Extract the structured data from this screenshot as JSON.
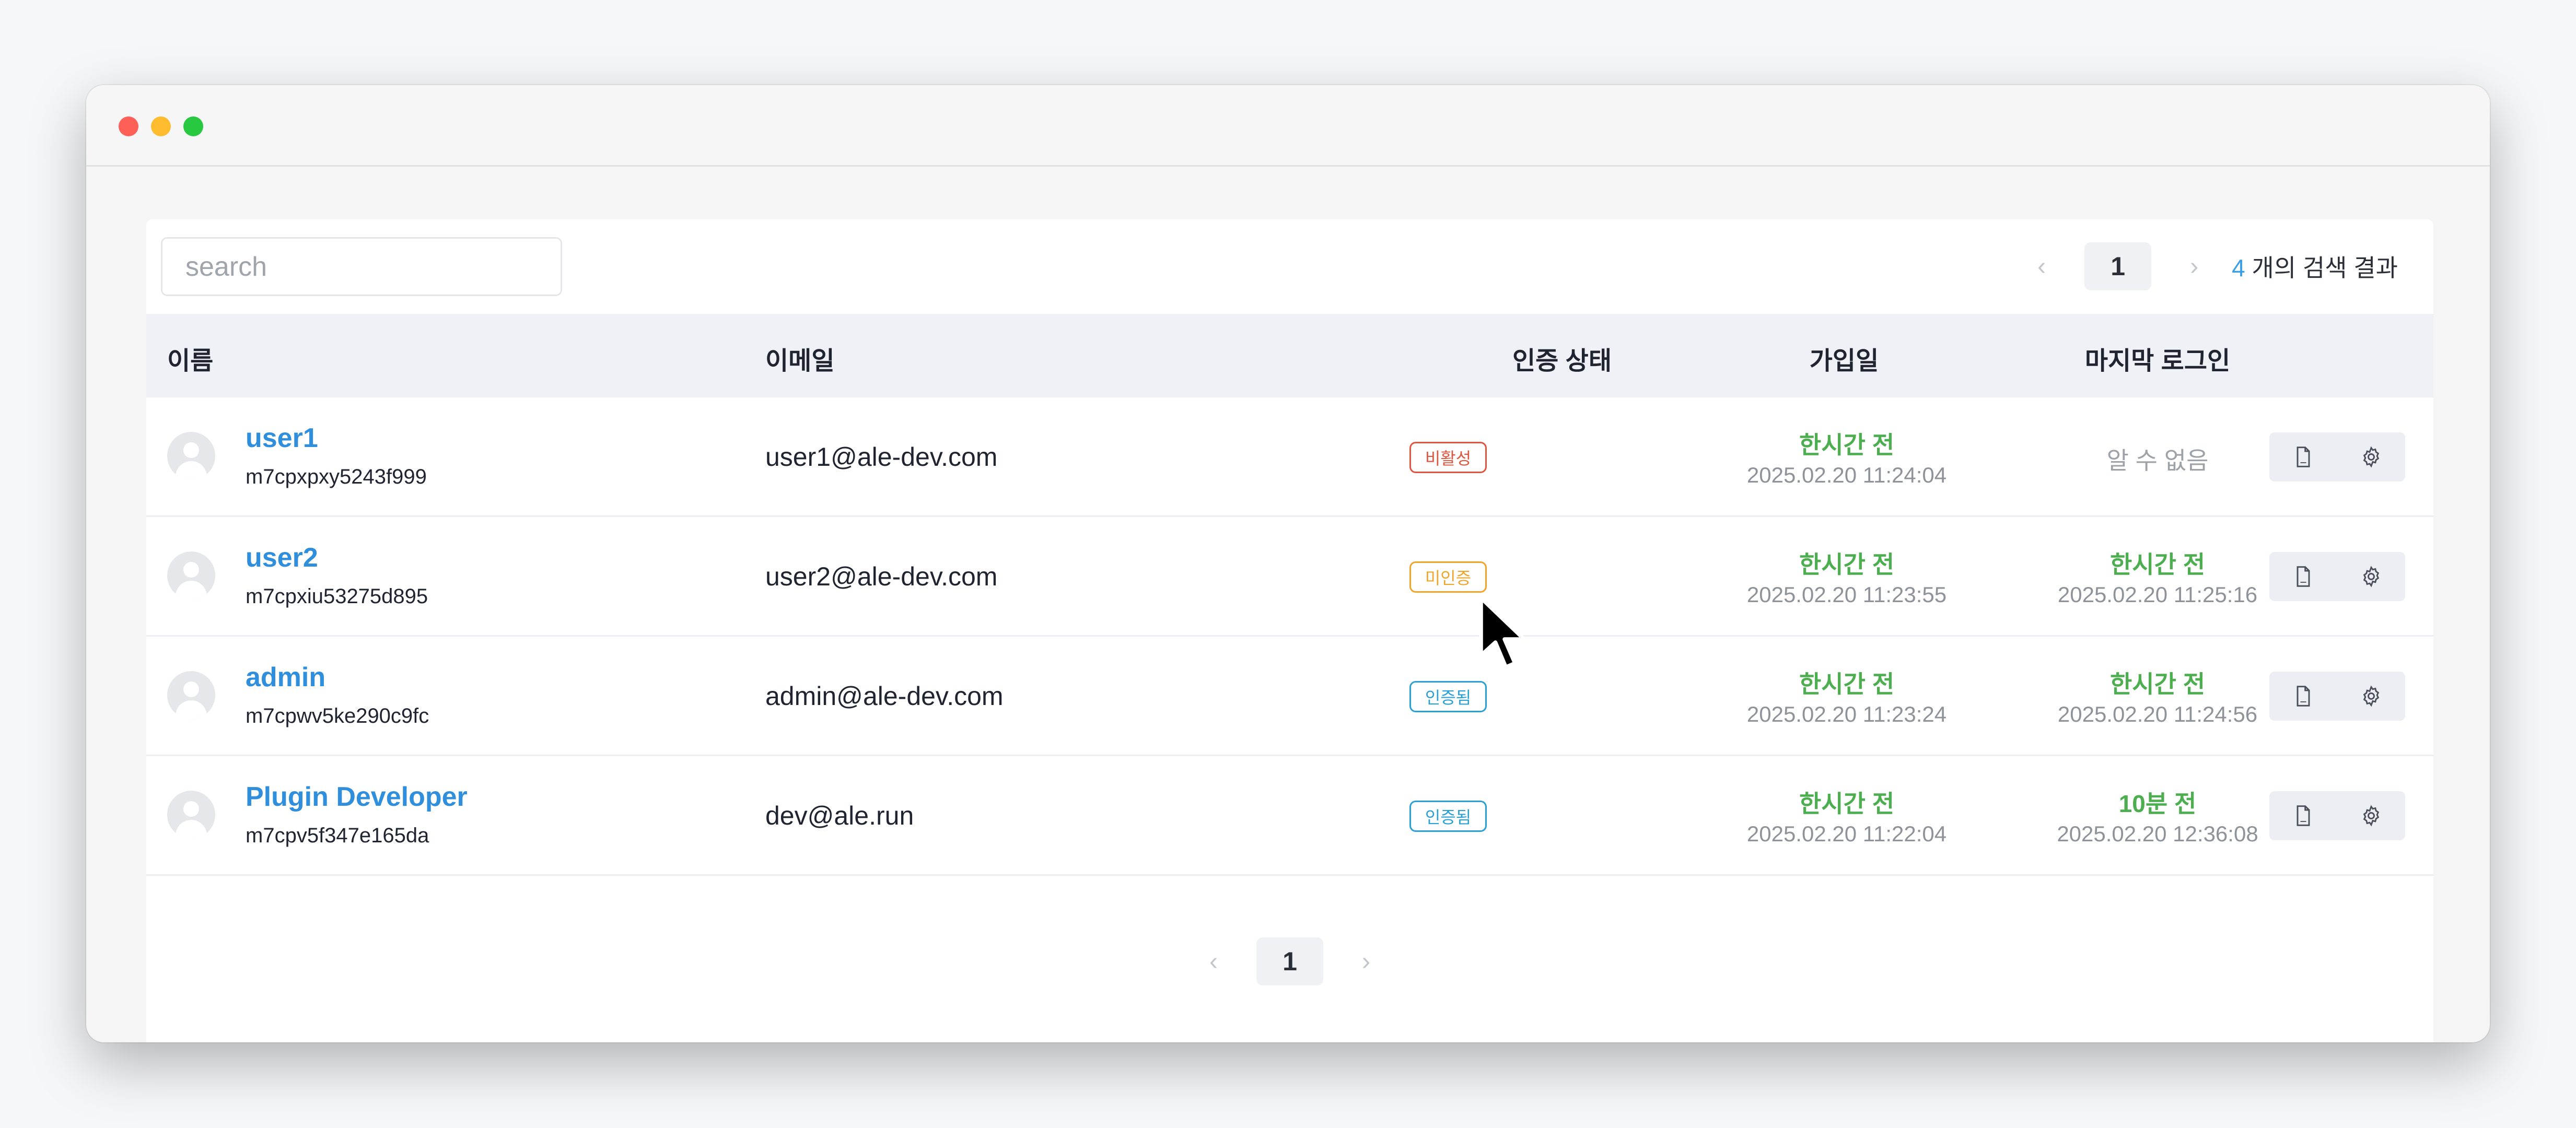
{
  "search": {
    "placeholder": "search"
  },
  "pager_top": {
    "prev": "‹",
    "page": "1",
    "next": "›"
  },
  "results": {
    "count": "4",
    "label": " 개의 검색 결과"
  },
  "columns": {
    "name": "이름",
    "email": "이메일",
    "auth": "인증 상태",
    "joined": "가입일",
    "last_login": "마지막 로그인"
  },
  "users": [
    {
      "name": "user1",
      "id": "m7cpxpxy5243f999",
      "email": "user1@ale-dev.com",
      "status": "비활성",
      "status_color": "#e0553e",
      "joined_rel": "한시간 전",
      "joined_at": "2025.02.20 11:24:04",
      "login_rel": "알 수 없음",
      "login_at": ""
    },
    {
      "name": "user2",
      "id": "m7cpxiu53275d895",
      "email": "user2@ale-dev.com",
      "status": "미인증",
      "status_color": "#f0a42a",
      "joined_rel": "한시간 전",
      "joined_at": "2025.02.20 11:23:55",
      "login_rel": "한시간 전",
      "login_at": "2025.02.20 11:25:16"
    },
    {
      "name": "admin",
      "id": "m7cpwv5ke290c9fc",
      "email": "admin@ale-dev.com",
      "status": "인증됨",
      "status_color": "#2aa0d6",
      "joined_rel": "한시간 전",
      "joined_at": "2025.02.20 11:23:24",
      "login_rel": "한시간 전",
      "login_at": "2025.02.20 11:24:56"
    },
    {
      "name": "Plugin Developer",
      "id": "m7cpv5f347e165da",
      "email": "dev@ale.run",
      "status": "인증됨",
      "status_color": "#2aa0d6",
      "joined_rel": "한시간 전",
      "joined_at": "2025.02.20 11:22:04",
      "login_rel": "10분 전",
      "login_at": "2025.02.20 12:36:08"
    }
  ],
  "pager_bottom": {
    "prev": "‹",
    "page": "1",
    "next": "›"
  },
  "icons": {
    "row_action_1": "document-icon",
    "row_action_2": "gear-icon",
    "avatar": "default-avatar-icon"
  },
  "colors": {
    "accent": "#3a9ee4",
    "link": "#2f8fdc",
    "success": "#4cae4f",
    "header_bg": "#eff1f6"
  }
}
